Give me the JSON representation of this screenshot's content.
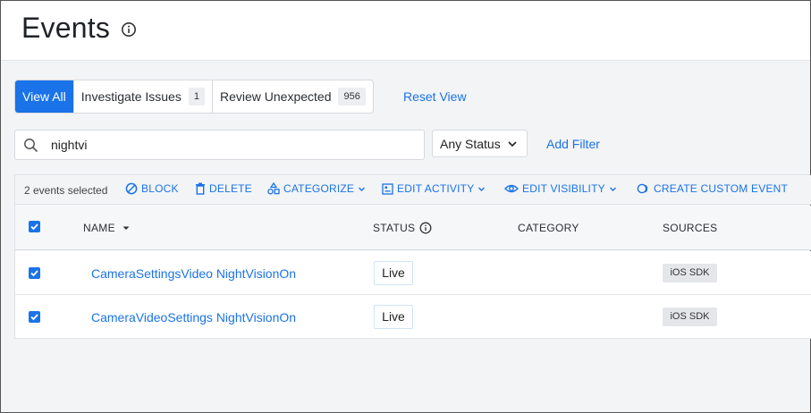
{
  "header": {
    "title": "Events",
    "info_icon": "info-circle-icon"
  },
  "views": {
    "tabs": [
      {
        "label": "View All",
        "active": true
      },
      {
        "label": "Investigate Issues",
        "count": "1"
      },
      {
        "label": "Review Unexpected",
        "count": "956"
      }
    ],
    "reset_label": "Reset View"
  },
  "filters": {
    "search_value": "nightvi",
    "status_label": "Any Status",
    "add_filter_label": "Add Filter"
  },
  "toolbar": {
    "selected_text": "2 events selected",
    "block": "BLOCK",
    "delete": "DELETE",
    "categorize": "CATEGORIZE",
    "edit_activity": "EDIT ACTIVITY",
    "edit_visibility": "EDIT VISIBILITY",
    "create_custom_event": "CREATE CUSTOM EVENT"
  },
  "table": {
    "columns": {
      "name": "NAME",
      "status": "STATUS",
      "category": "CATEGORY",
      "sources": "SOURCES"
    },
    "rows": [
      {
        "name": "CameraSettingsVideo NightVisionOn",
        "status": "Live",
        "category": "",
        "source": "iOS SDK",
        "checked": true
      },
      {
        "name": "CameraVideoSettings NightVisionOn",
        "status": "Live",
        "category": "",
        "source": "iOS SDK",
        "checked": true
      }
    ]
  },
  "colors": {
    "accent": "#1a73e8",
    "background": "#f3f4f6"
  }
}
